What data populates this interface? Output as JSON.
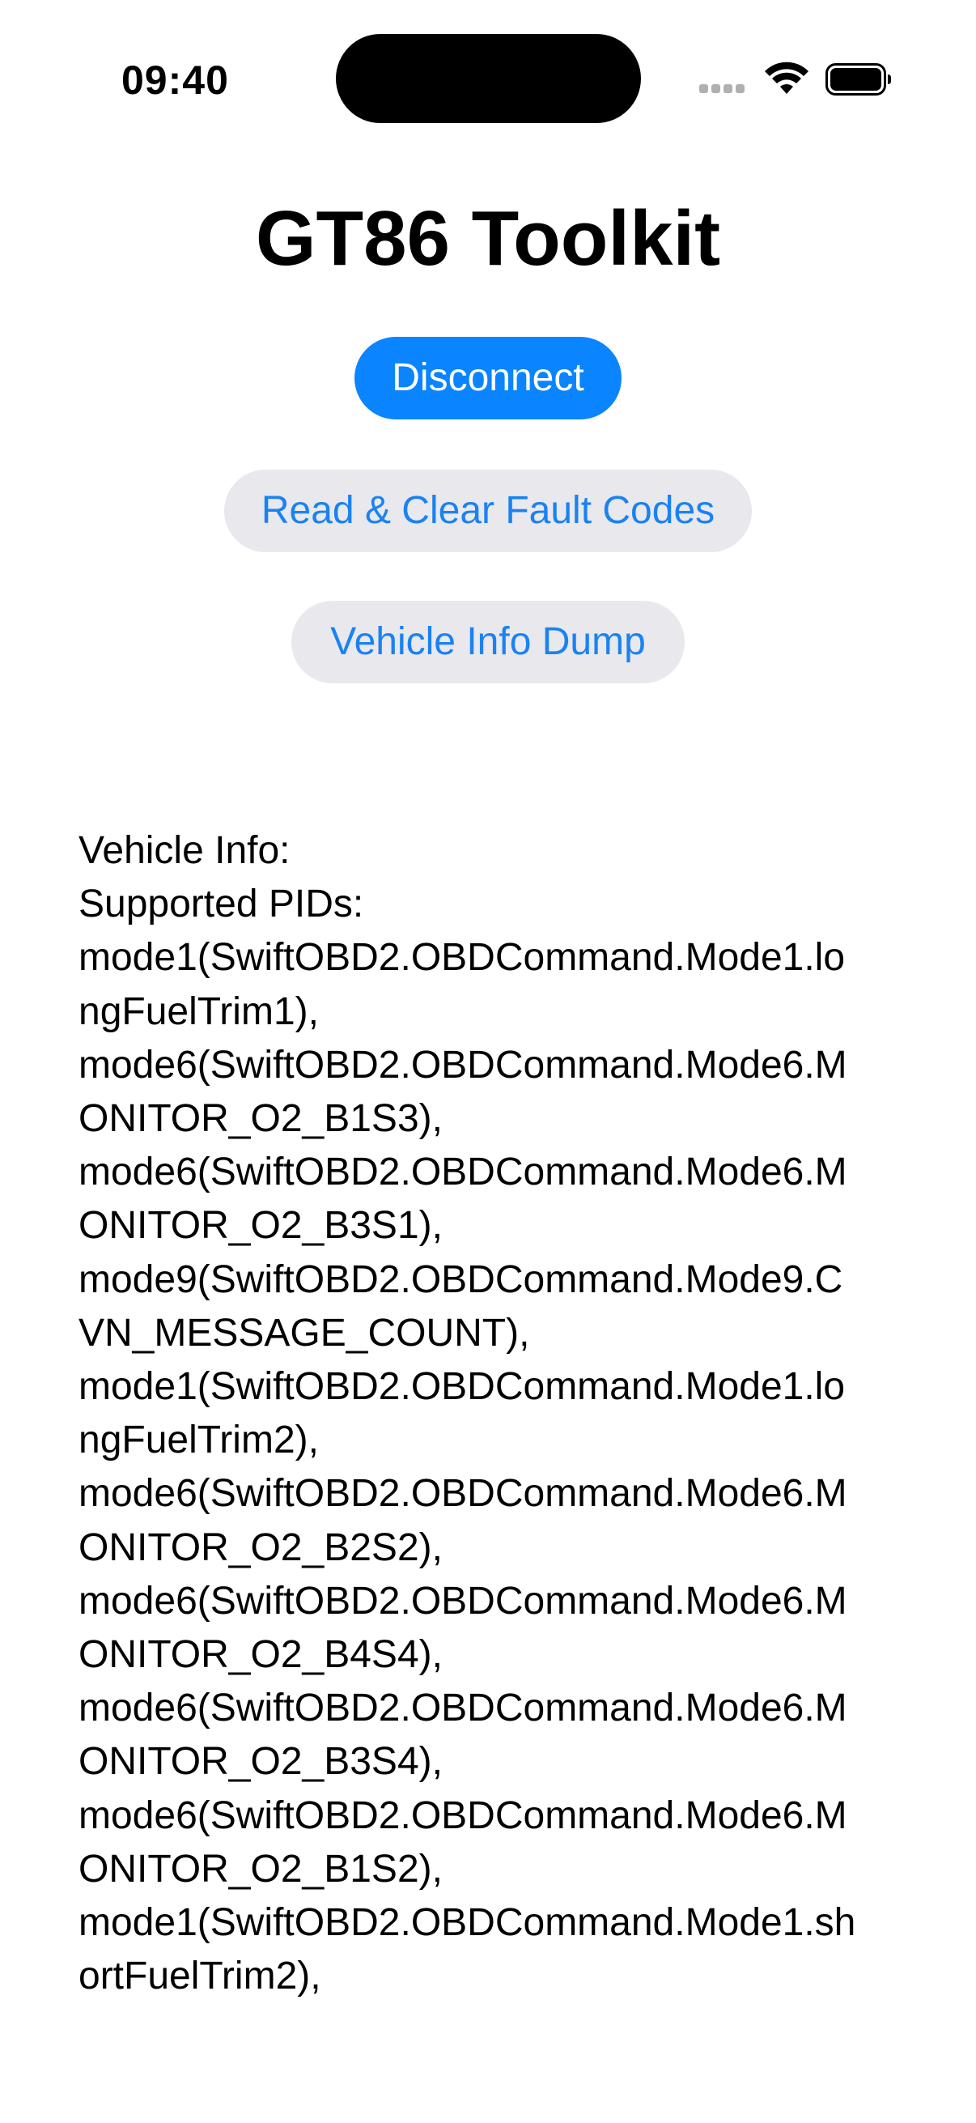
{
  "status_bar": {
    "time": "09:40",
    "icons": [
      "cellular-signal-icon",
      "wifi-icon",
      "battery-icon"
    ]
  },
  "header": {
    "title": "GT86 Toolkit"
  },
  "actions": {
    "disconnect_label": "Disconnect",
    "faults_label": "Read & Clear Fault Codes",
    "dump_label": "Vehicle Info Dump"
  },
  "colors": {
    "accent": "#0a84ff",
    "secondary_button_bg": "#e8e8ed",
    "secondary_button_text": "#1a82f2"
  },
  "output": {
    "text": "Vehicle Info:\nSupported PIDs:\nmode1(SwiftOBD2.OBDCommand.Mode1.lo\nngFuelTrim1),\nmode6(SwiftOBD2.OBDCommand.Mode6.M\nONITOR_O2_B1S3),\nmode6(SwiftOBD2.OBDCommand.Mode6.M\nONITOR_O2_B3S1),\nmode9(SwiftOBD2.OBDCommand.Mode9.C\nVN_MESSAGE_COUNT),\nmode1(SwiftOBD2.OBDCommand.Mode1.lo\nngFuelTrim2),\nmode6(SwiftOBD2.OBDCommand.Mode6.M\nONITOR_O2_B2S2),\nmode6(SwiftOBD2.OBDCommand.Mode6.M\nONITOR_O2_B4S4),\nmode6(SwiftOBD2.OBDCommand.Mode6.M\nONITOR_O2_B3S4),\nmode6(SwiftOBD2.OBDCommand.Mode6.M\nONITOR_O2_B1S2),\nmode1(SwiftOBD2.OBDCommand.Mode1.sh\nortFuelTrim2),"
  }
}
